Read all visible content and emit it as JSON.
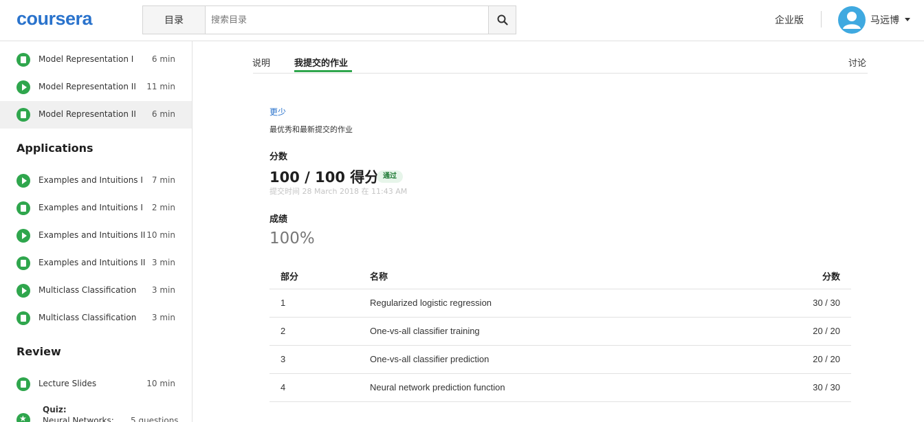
{
  "header": {
    "logo": "coursera",
    "catalog_label": "目录",
    "search_placeholder": "搜索目录",
    "enterprise_label": "企业版",
    "username": "马远博"
  },
  "sidebar": {
    "items_top": [
      {
        "icon": "document-icon",
        "label": "Model Representation I",
        "duration": "6 min"
      },
      {
        "icon": "play-icon",
        "label": "Model Representation II",
        "duration": "11 min"
      },
      {
        "icon": "document-icon",
        "label": "Model Representation II",
        "duration": "6 min",
        "active": true
      }
    ],
    "section_applications": "Applications",
    "items_applications": [
      {
        "icon": "play-icon",
        "label": "Examples and Intuitions I",
        "duration": "7 min"
      },
      {
        "icon": "document-icon",
        "label": "Examples and Intuitions I",
        "duration": "2 min"
      },
      {
        "icon": "play-icon",
        "label": "Examples and Intuitions II",
        "duration": "10 min"
      },
      {
        "icon": "document-icon",
        "label": "Examples and Intuitions II",
        "duration": "3 min"
      },
      {
        "icon": "play-icon",
        "label": "Multiclass Classification",
        "duration": "3 min"
      },
      {
        "icon": "document-icon",
        "label": "Multiclass Classification",
        "duration": "3 min"
      }
    ],
    "section_review": "Review",
    "items_review": [
      {
        "icon": "document-icon",
        "label": "Lecture Slides",
        "duration": "10 min"
      }
    ],
    "quiz": {
      "label": "Quiz:",
      "name": "Neural Networks:",
      "duration": "5 questions"
    }
  },
  "tabs": {
    "instructions": "说明",
    "my_submission": "我提交的作业",
    "discussions": "讨论"
  },
  "submission": {
    "less_link": "更少",
    "description": "最优秀和最新提交的作业",
    "score_label": "分数",
    "score": "100 / 100 得分",
    "badge": "通过",
    "submitted_at": "提交时间 28 March 2018 在 11:43 AM",
    "grade_label": "成绩",
    "grade": "100%"
  },
  "table": {
    "headers": [
      "部分",
      "名称",
      "分数"
    ],
    "rows": [
      [
        "1",
        "Regularized logistic regression",
        "30 / 30"
      ],
      [
        "2",
        "One-vs-all classifier training",
        "20 / 20"
      ],
      [
        "3",
        "One-vs-all classifier prediction",
        "20 / 20"
      ],
      [
        "4",
        "Neural network prediction function",
        "30 / 30"
      ]
    ]
  },
  "colors": {
    "brand_blue": "#2a73cc",
    "accent_green": "#2fa64d",
    "avatar_blue": "#3fa9e0"
  }
}
